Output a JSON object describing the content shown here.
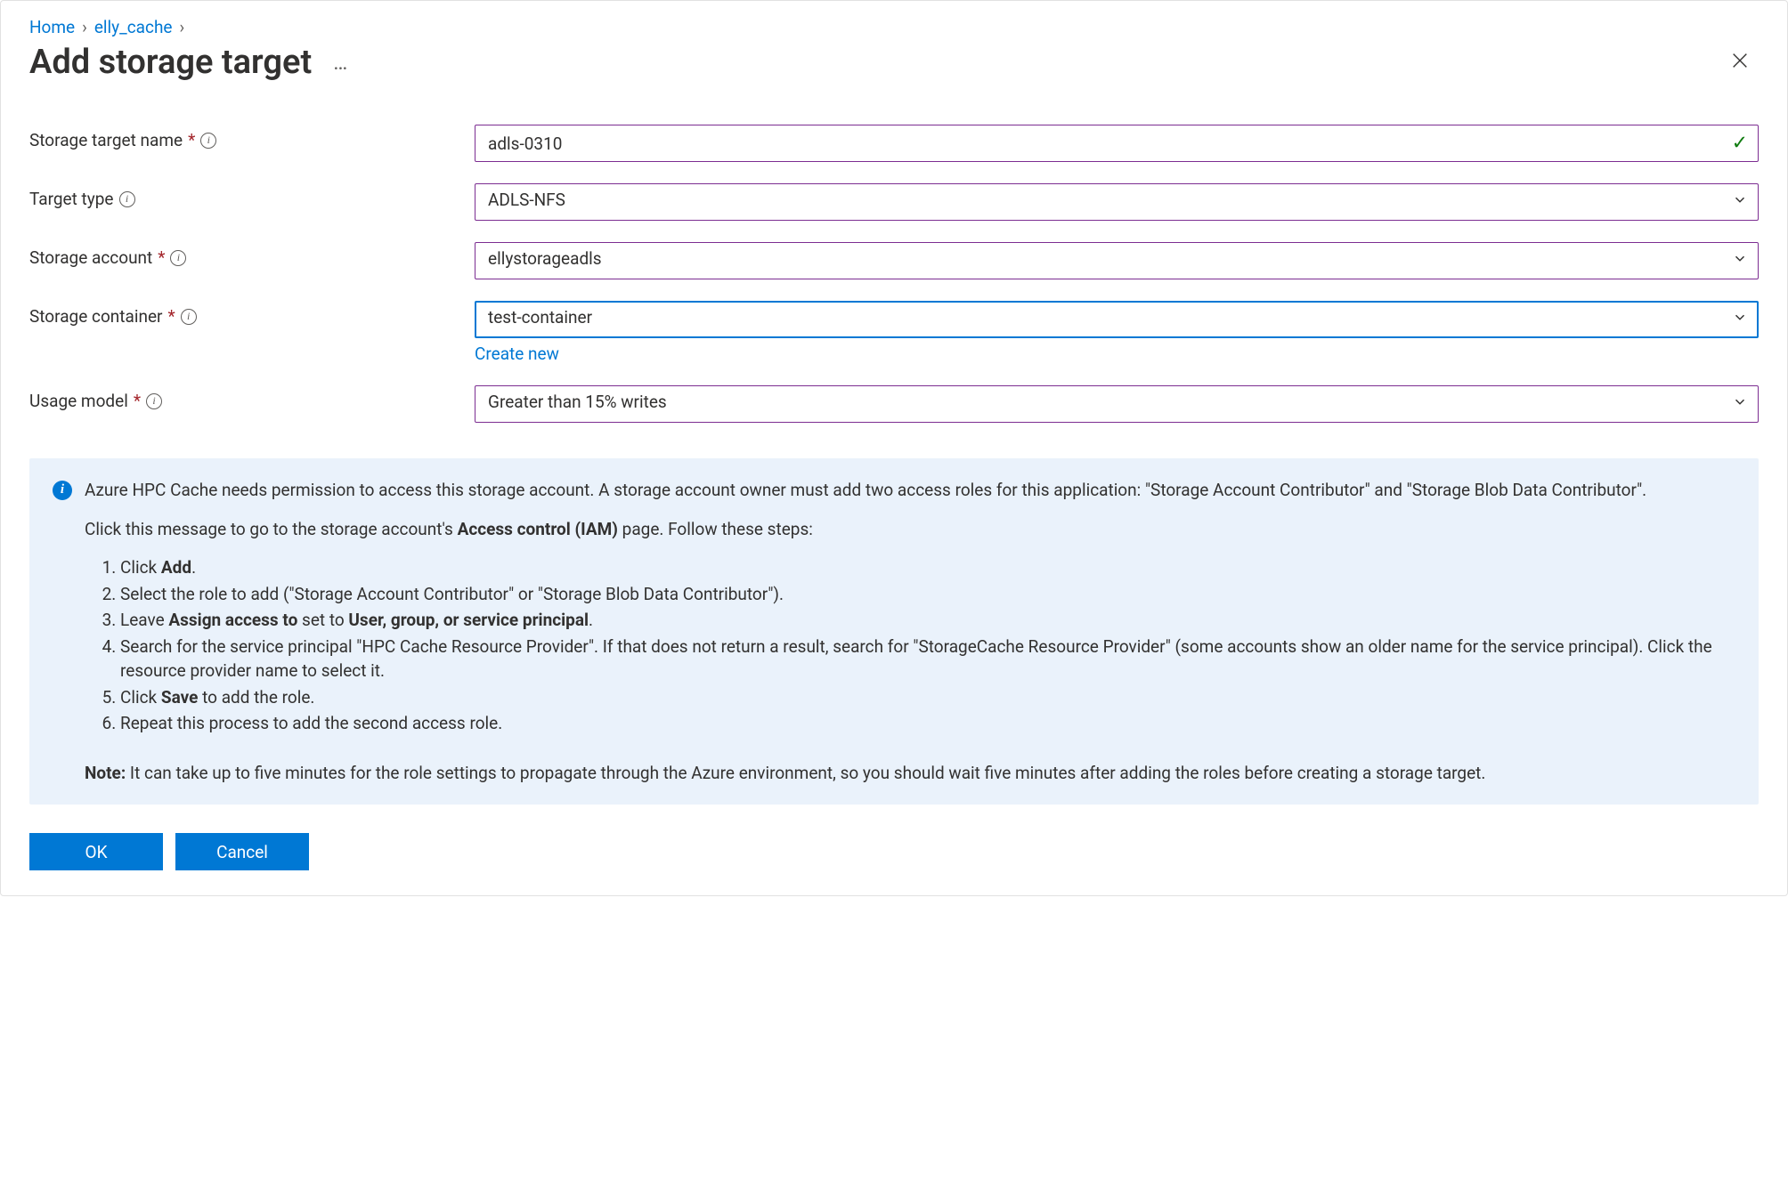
{
  "breadcrumb": {
    "home": "Home",
    "parent": "elly_cache"
  },
  "page": {
    "title": "Add storage target"
  },
  "form": {
    "storage_target_name": {
      "label": "Storage target name",
      "value": "adls-0310",
      "required": true
    },
    "target_type": {
      "label": "Target type",
      "value": "ADLS-NFS",
      "required": false
    },
    "storage_account": {
      "label": "Storage account",
      "value": "ellystorageadls",
      "required": true
    },
    "storage_container": {
      "label": "Storage container",
      "value": "test-container",
      "required": true,
      "create_new_label": "Create new"
    },
    "usage_model": {
      "label": "Usage model",
      "value": "Greater than 15% writes",
      "required": true
    }
  },
  "info": {
    "intro": "Azure HPC Cache needs permission to access this storage account. A storage account owner must add two access roles for this application: \"Storage Account Contributor\" and \"Storage Blob Data Contributor\".",
    "click_msg_prefix": "Click this message to go to the storage account's ",
    "click_msg_bold": "Access control (IAM)",
    "click_msg_suffix": " page. Follow these steps:",
    "steps": {
      "s1_a": "Click ",
      "s1_b": "Add",
      "s1_c": ".",
      "s2": "Select the role to add (\"Storage Account Contributor\" or \"Storage Blob Data Contributor\").",
      "s3_a": "Leave ",
      "s3_b": "Assign access to",
      "s3_c": " set to ",
      "s3_d": "User, group, or service principal",
      "s3_e": ".",
      "s4": "Search for the service principal \"HPC Cache Resource Provider\". If that does not return a result, search for \"StorageCache Resource Provider\" (some accounts show an older name for the service principal). Click the resource provider name to select it.",
      "s5_a": "Click ",
      "s5_b": "Save",
      "s5_c": " to add the role.",
      "s6": "Repeat this process to add the second access role."
    },
    "note_label": "Note:",
    "note_text": " It can take up to five minutes for the role settings to propagate through the Azure environment, so you should wait five minutes after adding the roles before creating a storage target."
  },
  "buttons": {
    "ok": "OK",
    "cancel": "Cancel"
  }
}
